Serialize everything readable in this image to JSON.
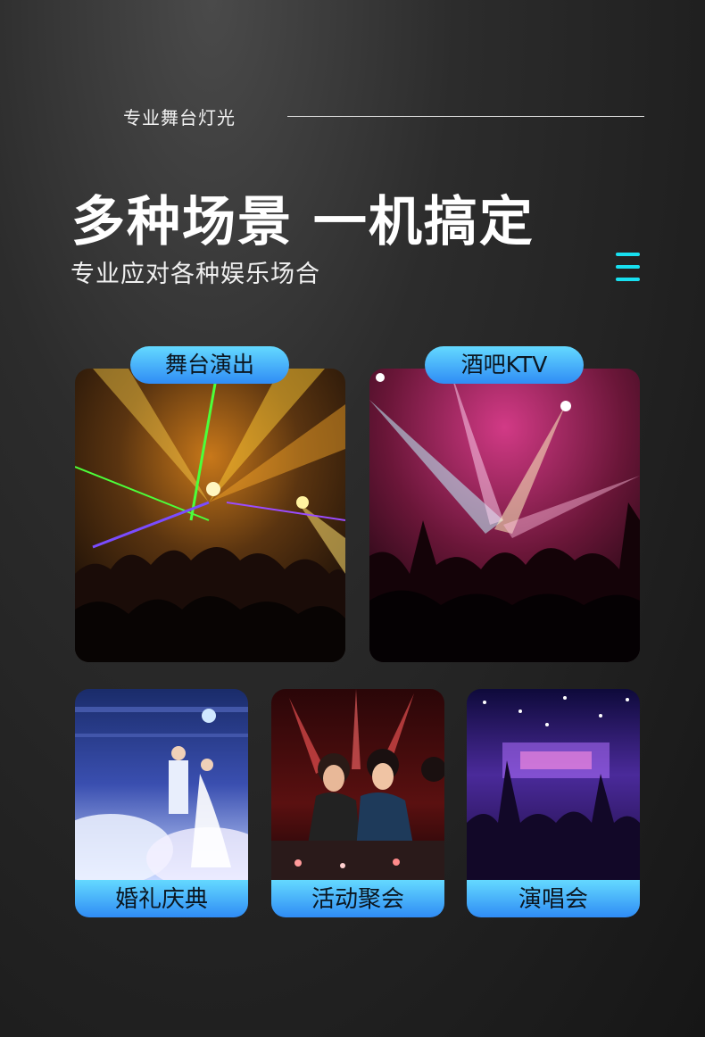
{
  "header": {
    "eyebrow": "专业舞台灯光",
    "headline": "多种场景 一机搞定",
    "subheadline": "专业应对各种娱乐场合"
  },
  "accent_color": "#18e0f0",
  "label_gradient": [
    "#64d9ff",
    "#2f8cf5"
  ],
  "menu_icon": "menu-icon",
  "scenes": [
    {
      "label": "舞台演出",
      "image": "stage-performance-photo"
    },
    {
      "label": "酒吧KTV",
      "image": "bar-ktv-photo"
    },
    {
      "label": "婚礼庆典",
      "image": "wedding-ceremony-photo"
    },
    {
      "label": "活动聚会",
      "image": "party-event-photo"
    },
    {
      "label": "演唱会",
      "image": "concert-photo"
    }
  ]
}
